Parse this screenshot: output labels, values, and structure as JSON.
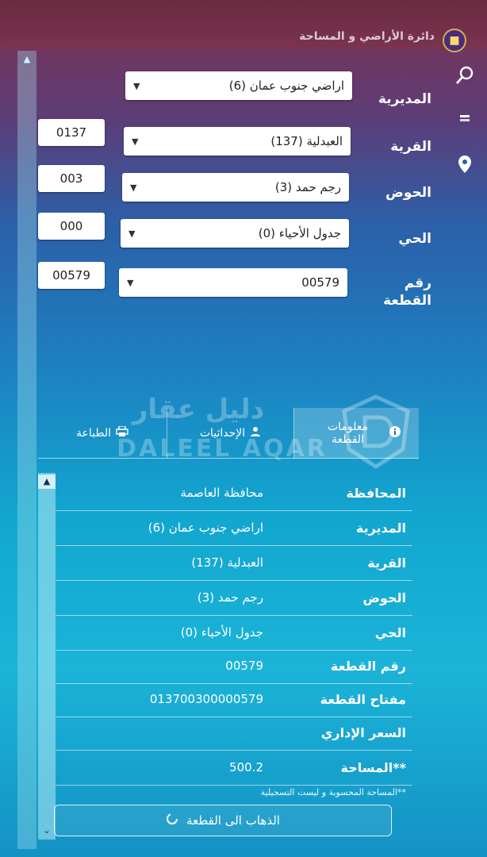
{
  "header": {
    "title": "دائرة الأراضي و المساحة"
  },
  "form": {
    "directorate": {
      "label": "المديرية",
      "value": "اراضي جنوب عمان (6)"
    },
    "village": {
      "label": "القرية",
      "value": "العبدلية (137)",
      "code": "0137"
    },
    "basin": {
      "label": "الحوض",
      "value": "رجم حمد (3)",
      "code": "003"
    },
    "quarter": {
      "label": "الحي",
      "value": "جدول الأحياء (0)",
      "code": "000"
    },
    "parcel": {
      "label": "رقم القطعة",
      "value": "00579",
      "code": "00579"
    }
  },
  "tabs": [
    {
      "label": "معلومات القطعة",
      "active": true
    },
    {
      "label": "الإحداثيات",
      "active": false
    },
    {
      "label": "الطباعة",
      "active": false
    }
  ],
  "watermark": {
    "arabic": "دليل عقار",
    "english": "DALEEL AQAR"
  },
  "parcel_info": [
    {
      "label": "المحافظة",
      "value": "محافظة العاصمة"
    },
    {
      "label": "المديرية",
      "value": "اراضي جنوب عمان (6)"
    },
    {
      "label": "القرية",
      "value": "العبدلية (137)"
    },
    {
      "label": "الحوض",
      "value": "رجم حمد (3)"
    },
    {
      "label": "الحي",
      "value": "جدول الأحياء (0)"
    },
    {
      "label": "رقم القطعة",
      "value": "00579"
    },
    {
      "label": "مفتاح القطعة",
      "value": "013700300000579"
    },
    {
      "label": "السعر الإداري",
      "value": ""
    },
    {
      "label": "**المساحة",
      "value": "500.2"
    }
  ],
  "footnote": "**المساحة المحسوبة و ليست التسجيلية",
  "goto_button": "الذهاب الى القطعة",
  "colors": {
    "topbar": "#7a3450",
    "accent": "#12a6cf"
  }
}
